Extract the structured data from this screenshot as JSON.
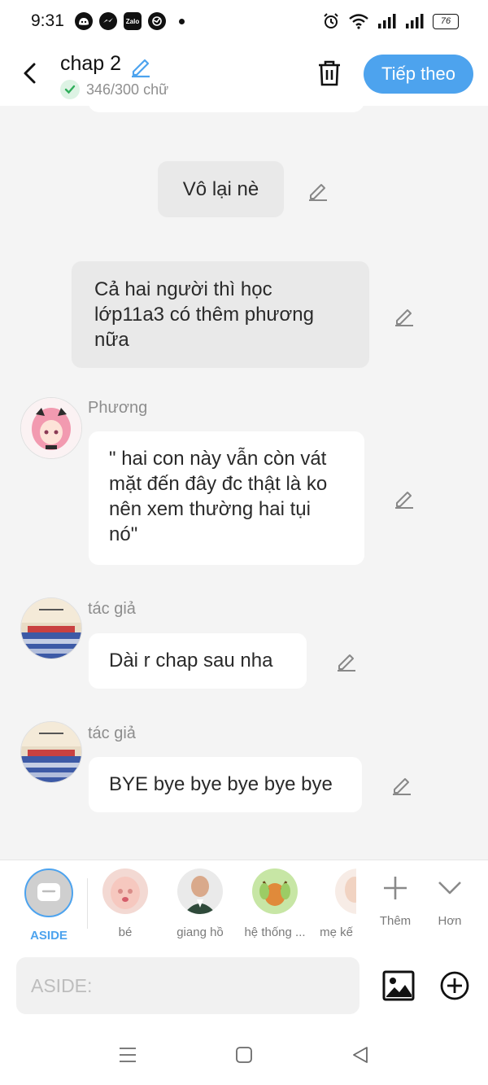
{
  "status_bar": {
    "time": "9:31",
    "app_icons": [
      "discord-icon",
      "messenger-icon",
      "zalo-icon",
      "globe-app-icon"
    ],
    "zalo_label": "Zalo",
    "battery": "76"
  },
  "header": {
    "title": "chap 2",
    "word_count": "346/300 chữ",
    "next_label": "Tiếp theo",
    "accent_color": "#4da3ee"
  },
  "messages": [
    {
      "kind": "narration",
      "text": "Vô lại nè"
    },
    {
      "kind": "narration",
      "text": "Cả hai người thì học lớp11a3 có thêm phương nữa"
    },
    {
      "kind": "character",
      "speaker": "Phương",
      "text": "\" hai con này vẫn còn vát mặt đến đây đc thật là ko nên xem thường hai tụi nó\""
    },
    {
      "kind": "character",
      "speaker": "tác giả",
      "text": "Dài r chap sau nha"
    },
    {
      "kind": "character",
      "speaker": "tác giả",
      "text": "BYE bye bye bye bye bye"
    }
  ],
  "character_bar": {
    "selected": "ASIDE",
    "items": [
      "ASIDE",
      "bé",
      "giang hồ",
      "hệ thống ...",
      "mẹ kế"
    ],
    "more_label": "Thêm",
    "expand_label": "Hơn"
  },
  "composer": {
    "placeholder": "ASIDE:"
  }
}
